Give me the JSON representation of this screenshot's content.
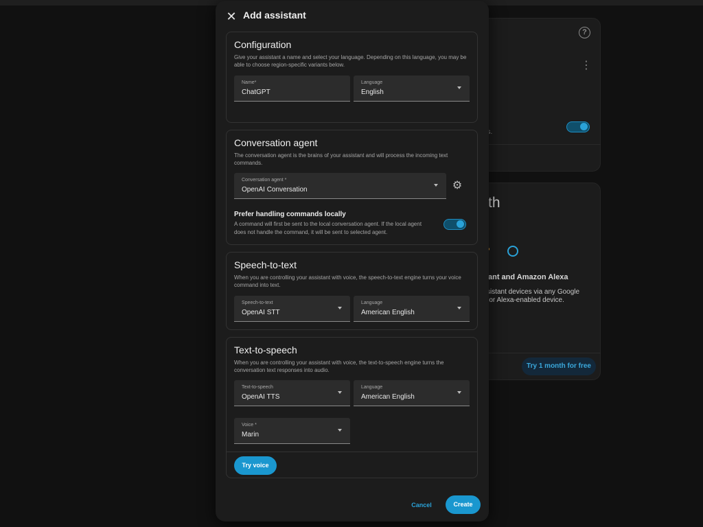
{
  "background": {
    "card1_body_fragment": "es.",
    "card2_heading_fragment": "th",
    "card2_subheading": "ant and Amazon Alexa",
    "card2_body_line1": "ssistant devices via any Google",
    "card2_body_line2": "d or Alexa-enabled device.",
    "card2_cta": "Try 1 month for free"
  },
  "dialog": {
    "title": "Add assistant",
    "close_icon": "close-icon",
    "configuration": {
      "title": "Configuration",
      "description": "Give your assistant a name and select your language. Depending on this language, you may be able to choose region-specific variants below.",
      "name_label": "Name*",
      "name_value": "ChatGPT",
      "language_label": "Language",
      "language_value": "English"
    },
    "conversation_agent": {
      "title": "Conversation agent",
      "description": "The conversation agent is the brains of your assistant and will process the incoming text commands.",
      "agent_label": "Conversation agent *",
      "agent_value": "OpenAI Conversation",
      "prefer_local_title": "Prefer handling commands locally",
      "prefer_local_description": "A command will first be sent to the local conversation agent. If the local agent does not handle the command, it will be sent to selected agent.",
      "prefer_local_enabled": true
    },
    "speech_to_text": {
      "title": "Speech-to-text",
      "description": "When you are controlling your assistant with voice, the speech-to-text engine turns your voice command into text.",
      "engine_label": "Speech-to-text",
      "engine_value": "OpenAI STT",
      "language_label": "Language",
      "language_value": "American English"
    },
    "text_to_speech": {
      "title": "Text-to-speech",
      "description": "When you are controlling your assistant with voice, the text-to-speech engine turns the conversation text responses into audio.",
      "engine_label": "Text-to-speech",
      "engine_value": "OpenAI TTS",
      "language_label": "Language",
      "language_value": "American English",
      "voice_label": "Voice *",
      "voice_value": "Marin",
      "try_voice_label": "Try voice"
    },
    "cancel_label": "Cancel",
    "create_label": "Create"
  },
  "colors": {
    "accent": "#1a97cf",
    "surface": "#1c1c1c",
    "field": "#2c2c2c",
    "backdrop": "#111111"
  }
}
